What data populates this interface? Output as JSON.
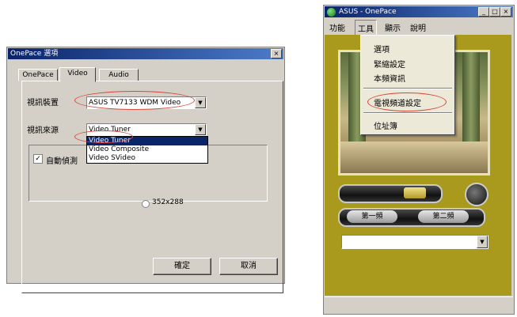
{
  "dialog": {
    "title": "OnePace 選項",
    "close": "×",
    "tabs": [
      {
        "label": "OnePace"
      },
      {
        "label": "Video"
      },
      {
        "label": "Audio"
      }
    ],
    "device_label": "視訊裝置",
    "device_value": "ASUS TV7133 WDM Video",
    "source_label": "視訊來源",
    "source_value": "Video Tuner",
    "source_options": [
      "Video Tuner",
      "Video Composite",
      "Video SVideo"
    ],
    "checkbox_label": "自動偵測",
    "radio_label": "352x288",
    "ok_label": "確定",
    "cancel_label": "取消"
  },
  "app": {
    "title": "ASUS - OnePace",
    "menubar": [
      "功能",
      "工具",
      "顯示",
      "說明"
    ],
    "tools_menu": [
      "選項",
      "緊縮設定",
      "本頻資訊",
      "電視頻道設定",
      "位址簿"
    ],
    "channel_left": "第一頻",
    "channel_right": "第二頻",
    "win_buttons": [
      "_",
      "□",
      "×"
    ]
  },
  "colors": {
    "app_bg": "#a99a1e",
    "highlight": "#d9443a",
    "title_blue": "#0a246a",
    "dialog_bg": "#d4d0c8"
  }
}
